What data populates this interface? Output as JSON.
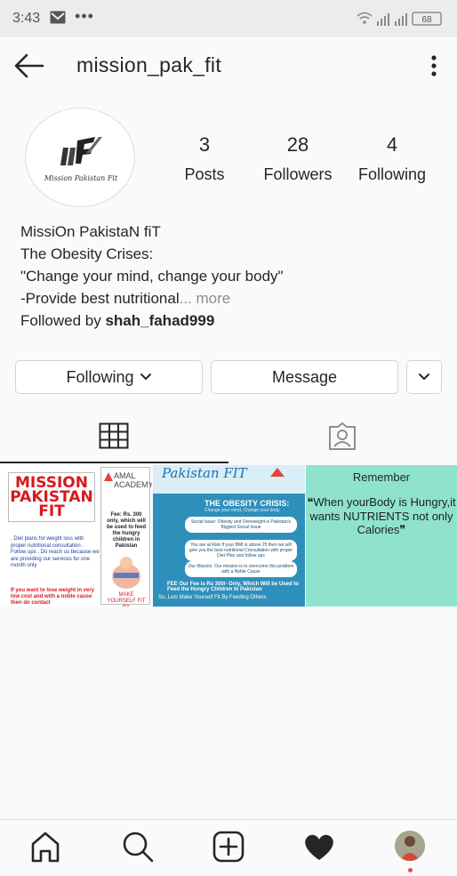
{
  "status_bar": {
    "time": "3:43",
    "battery": "68",
    "icons": [
      "mail-icon",
      "more-dots-icon",
      "wifi-icon",
      "signal-icon",
      "signal-icon",
      "battery-icon"
    ],
    "dots": "•••"
  },
  "header": {
    "username": "mission_pak_fit",
    "back_icon": "arrow-left-icon",
    "menu_icon": "vertical-dots-icon"
  },
  "profile": {
    "avatar_text": "Mission Pakistan Fit",
    "stats": [
      {
        "count": "3",
        "label": "Posts"
      },
      {
        "count": "28",
        "label": "Followers"
      },
      {
        "count": "4",
        "label": "Following"
      }
    ]
  },
  "bio": {
    "name": "MissiOn PakistaN fiT",
    "line1": "The Obesity Crises:",
    "line2": "\"Change your mind, change your body\"",
    "line3": "-Provide best nutritional",
    "ellipsis": "...",
    "more": " more",
    "followed_by_prefix": "Followed by ",
    "followed_by_user": "shah_fahad999"
  },
  "buttons": {
    "following": "Following",
    "message": "Message",
    "suggest_icon": "chevron-down-icon"
  },
  "tabs": [
    {
      "icon": "grid-icon",
      "active": true
    },
    {
      "icon": "tagged-person-icon",
      "active": false
    }
  ],
  "posts": {
    "post1": {
      "title": "MISSION PAKISTAN FIT",
      "list": ". Diet plans for weight loss with proper nutritional consultation . Follow ups . Do reach us because we are providing our services for one month only",
      "bottom": "If you want to lose weight in very low cost and with a noble cause then do contact",
      "academy": "AMAL ACADEMY",
      "fee": "Fee: Rs. 300 only, which will be used to feed the hungry children in Pakistan",
      "make": "MAKE YOURSELF FIT BY"
    },
    "post2": {
      "title": "Pakistan FIT",
      "heading": "THE OBESITY CRISIS:",
      "subheading": "Change your mind, Change your body",
      "box1": "Social Issue: Obesity and Overweight is Pakistan's Biggest Social Issue",
      "box2": "You are at Risk If your BMI is above 25 then we will give you the best nutritional Consultation with proper Diet Plan and follow ups",
      "box3": "Our Mission. Our mission is to overcome this problem with a Noble Cause",
      "fee": "FEE Our Fee is Rs 300/- Only, Which Will be Used to Feed the Hungry Children In Pakistan",
      "bottom": "So, Lets Make Yourself Fit By Feeding Others"
    },
    "post3": {
      "remember": "Remember",
      "quote_open": "❝",
      "quote": "When yourBody is Hungry,it wants NUTRIENTS not only Calories",
      "quote_close": "❞"
    }
  },
  "bottom_nav": [
    {
      "icon": "home-icon"
    },
    {
      "icon": "search-icon"
    },
    {
      "icon": "add-post-icon"
    },
    {
      "icon": "heart-icon"
    },
    {
      "icon": "profile-avatar-icon"
    }
  ]
}
